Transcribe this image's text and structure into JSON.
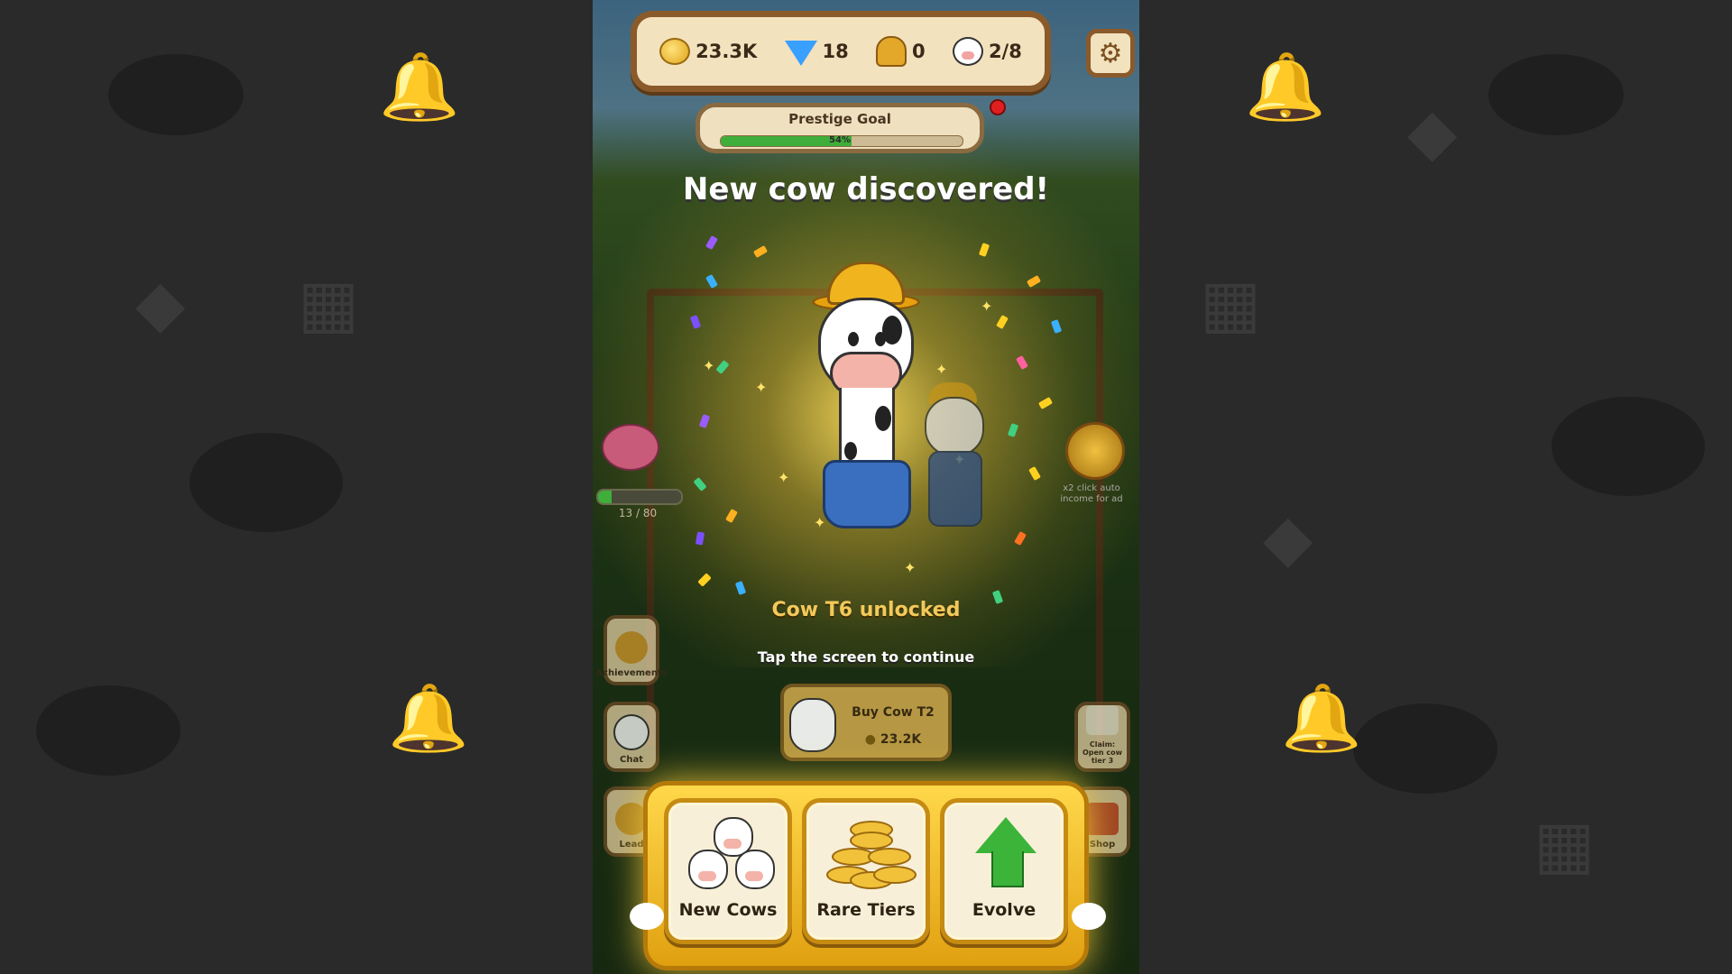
{
  "resources": {
    "coins": "23.3K",
    "gems": "18",
    "bells": "0",
    "cows": "2/8"
  },
  "prestige": {
    "title": "Prestige Goal",
    "percent_label": "54%",
    "progress": 0.54
  },
  "headline": "New cow discovered!",
  "unlocked_text": "Cow T6 unlocked",
  "tap_text": "Tap the screen to continue",
  "side_progress": {
    "label": "13 / 80",
    "value": 13,
    "max": 80
  },
  "ad_text": "x2 click auto income for ad",
  "side_buttons": {
    "achievements": "Achievements",
    "chat": "Chat",
    "leaderboard": "Lead",
    "claim": "Claim: Open cow tier 3",
    "shop": "Shop"
  },
  "buy_button": {
    "title": "Buy Cow T2",
    "price": "23.2K"
  },
  "bottom_cards": [
    "New Cows",
    "Rare Tiers",
    "Evolve"
  ],
  "colors": {
    "accent_gold": "#f3c95a",
    "panel_gold": "#ffd84a",
    "wood": "#8a5a2b",
    "progress_green": "#3fae3a"
  },
  "icons": [
    "coin-stack-icon",
    "gem-icon",
    "bell-icon",
    "cow-face-icon",
    "gear-icon",
    "piggy-bank-icon",
    "coin-bag-icon",
    "trophy-icon",
    "chat-icon",
    "scroll-icon",
    "shop-icon",
    "up-arrow-icon"
  ]
}
